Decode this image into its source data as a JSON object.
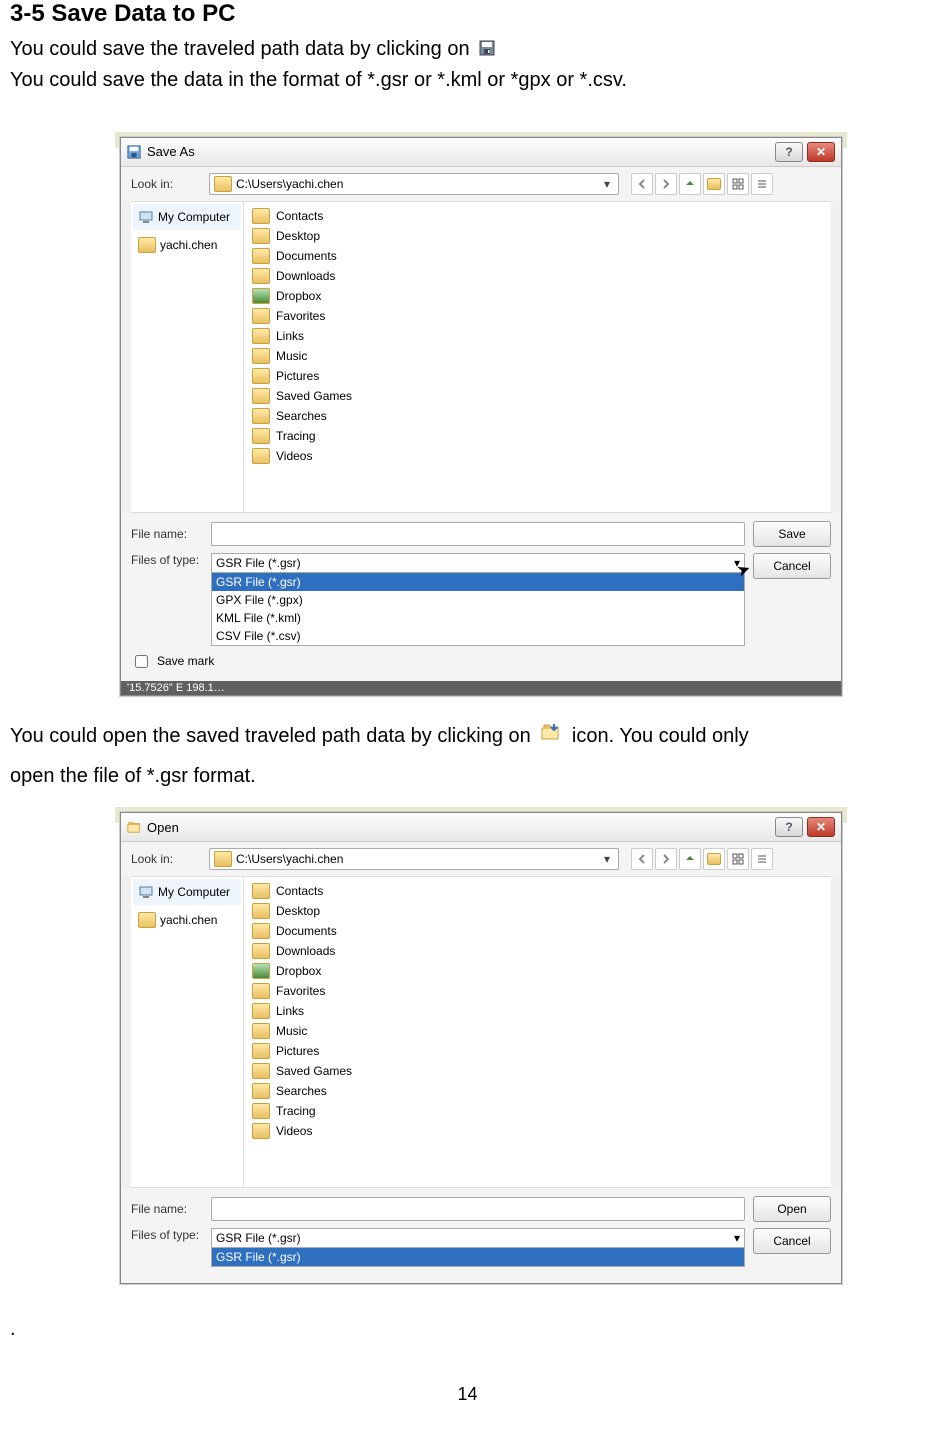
{
  "heading": "3-5 Save Data to PC",
  "intro": {
    "line1_a": "You could save the traveled path data by clicking on",
    "line2": "You could save the data in the format of *.gsr or *.kml or *gpx or *.csv."
  },
  "mid_text": {
    "a": "You could open the saved traveled path data by clicking on",
    "b": "icon. You could only",
    "c": "open the file of *.gsr format."
  },
  "dialog_save": {
    "title": "Save As",
    "look_in_label": "Look in:",
    "path": "C:\\Users\\yachi.chen",
    "sidebar": [
      "My Computer",
      "yachi.chen"
    ],
    "folders": [
      "Contacts",
      "Desktop",
      "Documents",
      "Downloads",
      "Dropbox",
      "Favorites",
      "Links",
      "Music",
      "Pictures",
      "Saved Games",
      "Searches",
      "Tracing",
      "Videos"
    ],
    "file_name_label": "File name:",
    "files_of_type_label": "Files of type:",
    "save_btn": "Save",
    "cancel_btn": "Cancel",
    "filetype_selected": "GSR File (*.gsr)",
    "filetype_options": [
      "GSR File (*.gsr)",
      "GPX File (*.gpx)",
      "KML File (*.kml)",
      "CSV File (*.csv)"
    ],
    "save_marker_label": "Save mark",
    "status": "'15.7526\" E  198.1…"
  },
  "dialog_open": {
    "title": "Open",
    "look_in_label": "Look in:",
    "path": "C:\\Users\\yachi.chen",
    "sidebar": [
      "My Computer",
      "yachi.chen"
    ],
    "folders": [
      "Contacts",
      "Desktop",
      "Documents",
      "Downloads",
      "Dropbox",
      "Favorites",
      "Links",
      "Music",
      "Pictures",
      "Saved Games",
      "Searches",
      "Tracing",
      "Videos"
    ],
    "file_name_label": "File name:",
    "files_of_type_label": "Files of type:",
    "open_btn": "Open",
    "cancel_btn": "Cancel",
    "filetype_selected": "GSR File (*.gsr)",
    "filetype_options": [
      "GSR File (*.gsr)"
    ]
  },
  "trailing_dot": ".",
  "page_number": "14"
}
